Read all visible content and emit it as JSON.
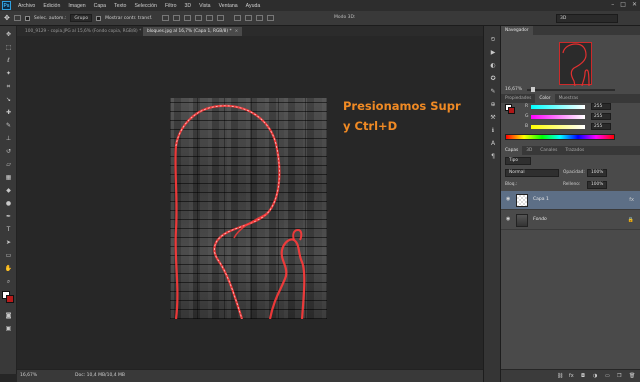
{
  "app": {
    "logo": "Ps"
  },
  "menu": [
    "Archivo",
    "Edición",
    "Imagen",
    "Capa",
    "Texto",
    "Selección",
    "Filtro",
    "3D",
    "Vista",
    "Ventana",
    "Ayuda"
  ],
  "window_controls": [
    "–",
    "□",
    "✕"
  ],
  "options": {
    "auto_select_label": "Selec. autom.:",
    "group_value": "Grupo",
    "transform_label": "Mostrar contr. transf.",
    "mode3d_label": "Modo 3D:",
    "workspace_value": "3D"
  },
  "tabs": [
    {
      "label": "100_9129 - copia.JPG al 15,6% (Fondo copia, RGB/8) *",
      "close": "×"
    },
    {
      "label": "bloques.jpg al 16,7% (Capa 1, RGB/8) *",
      "close": "×"
    }
  ],
  "annotation": {
    "line1": "Presionamos Supr",
    "line2": "y Ctrl+D"
  },
  "status": {
    "zoom": "16,67%",
    "doc": "Doc: 10,4 MB/10,4 MB"
  },
  "navigator": {
    "tab": "Navegador",
    "zoom": "16,67%"
  },
  "color_panel": {
    "tabs": [
      "Propiedades",
      "Color",
      "Muestras"
    ],
    "channels": [
      {
        "label": "R",
        "value": "255"
      },
      {
        "label": "G",
        "value": "255"
      },
      {
        "label": "B",
        "value": "255"
      }
    ]
  },
  "layers_panel": {
    "tabs": [
      "Capas",
      "3D",
      "Canales",
      "Trazados"
    ],
    "kind_value": "Tipo",
    "blend_value": "Normal",
    "opacity_label": "Opacidad:",
    "opacity_value": "100%",
    "lock_label": "Bloq.:",
    "fill_label": "Relleno:",
    "fill_value": "100%",
    "layers": [
      {
        "name": "Capa 1",
        "selected": true,
        "fx": "fx"
      },
      {
        "name": "Fondo",
        "selected": false,
        "lock": "🔒"
      }
    ]
  }
}
